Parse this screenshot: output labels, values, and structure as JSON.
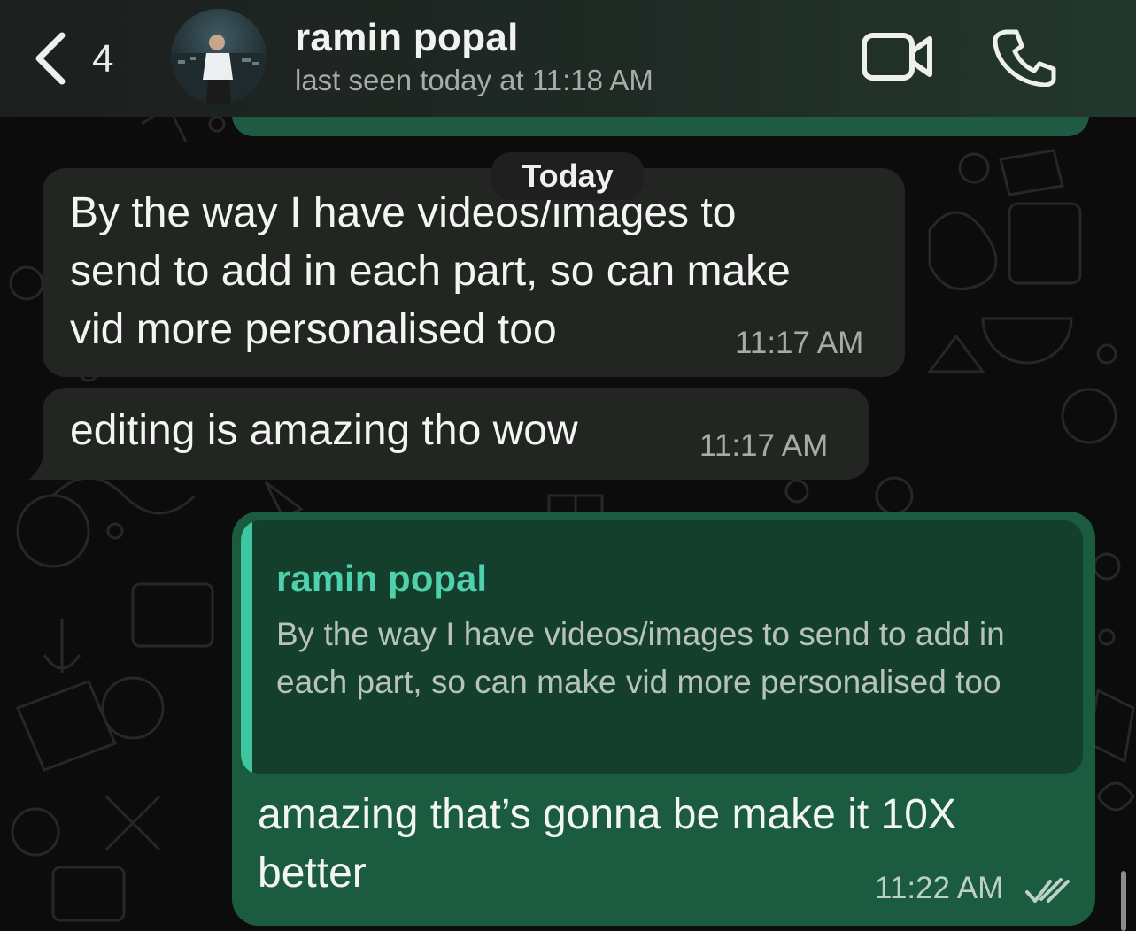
{
  "header": {
    "back_count": "4",
    "contact_name": "ramin popal",
    "status": "last seen today at 11:18 AM"
  },
  "date_chip": "Today",
  "messages": [
    {
      "direction": "incoming",
      "text": "By the way I have videos/images to\nsend to add in each part, so can make\nvid more personalised too",
      "time": "11:17 AM"
    },
    {
      "direction": "incoming",
      "text": "editing is amazing tho wow",
      "time": "11:17 AM"
    },
    {
      "direction": "outgoing",
      "reply_to": {
        "author": "ramin popal",
        "text": "By the way I have videos/images to send to add in each part, so can make vid more personalised too"
      },
      "text": "amazing that’s gonna be make it 10X better",
      "time": "11:22 AM",
      "status_icon": "double-check-icon"
    }
  ],
  "colors": {
    "header_bg": "#1f2a25",
    "incoming_bubble": "#232523",
    "outgoing_bubble": "#1b5b3f",
    "quote_accent": "#3ec79f"
  }
}
